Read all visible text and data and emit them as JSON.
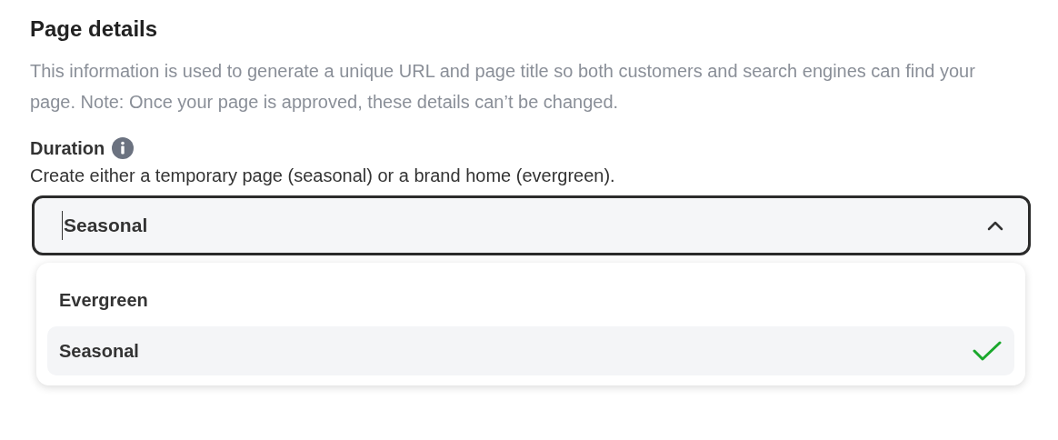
{
  "section": {
    "title": "Page details",
    "description": "This information is used to generate a unique URL and page title so both customers and search engines can find your page. Note: Once your page is approved, these details can’t be changed."
  },
  "duration": {
    "label": "Duration",
    "hint": "Create either a temporary page (seasonal) or a brand home (evergreen).",
    "value": "Seasonal",
    "expanded": true,
    "options": [
      {
        "label": "Evergreen",
        "selected": false
      },
      {
        "label": "Seasonal",
        "selected": true
      }
    ]
  }
}
